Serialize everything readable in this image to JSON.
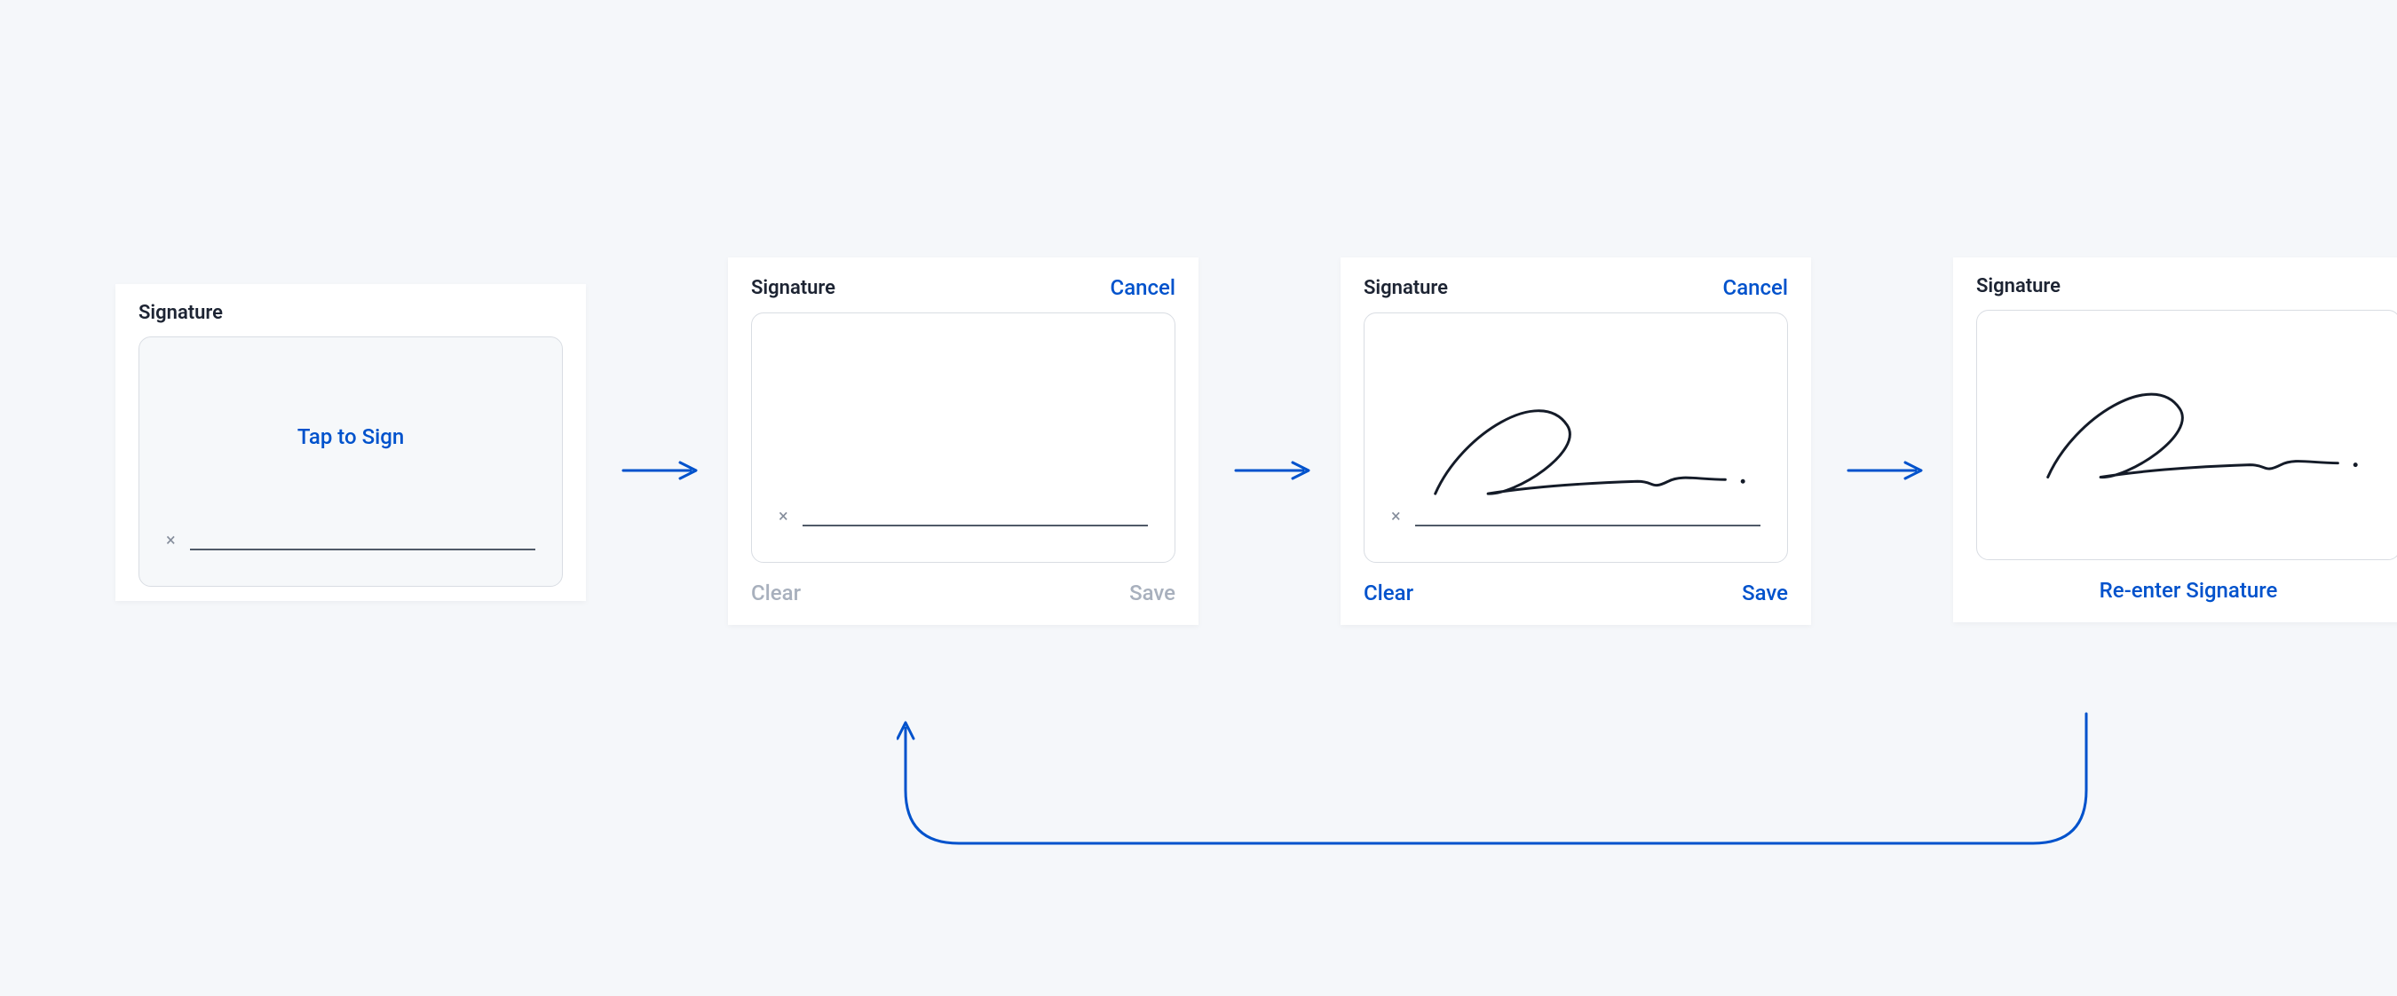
{
  "glyphs": {
    "x": "×"
  },
  "colors": {
    "primary": "#0052cc",
    "border": "#d9dde3",
    "text": "#1d2433",
    "muted": "#a8b0bd"
  },
  "cards": {
    "step1": {
      "title": "Signature",
      "prompt": "Tap to Sign"
    },
    "step2": {
      "title": "Signature",
      "cancel": "Cancel",
      "clear": "Clear",
      "save": "Save"
    },
    "step3": {
      "title": "Signature",
      "cancel": "Cancel",
      "clear": "Clear",
      "save": "Save"
    },
    "step4": {
      "title": "Signature",
      "reenter": "Re-enter Signature"
    }
  }
}
